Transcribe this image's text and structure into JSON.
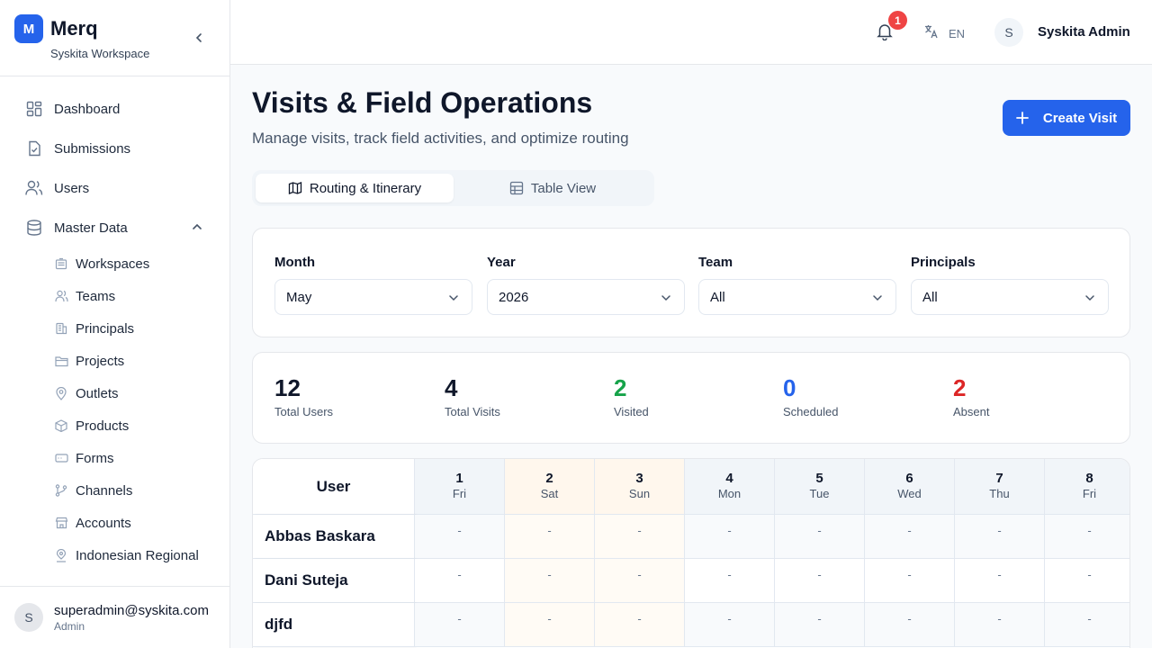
{
  "app": {
    "name": "Merq",
    "logo_letter": "M",
    "workspace": "Syskita Workspace"
  },
  "sidebar": {
    "items": [
      {
        "label": "Dashboard",
        "icon": "dashboard-icon"
      },
      {
        "label": "Submissions",
        "icon": "file-check-icon"
      },
      {
        "label": "Users",
        "icon": "users-icon"
      },
      {
        "label": "Master Data",
        "icon": "database-icon",
        "expanded": true
      }
    ],
    "sub_items": [
      {
        "label": "Workspaces",
        "icon": "building-icon"
      },
      {
        "label": "Teams",
        "icon": "users-icon"
      },
      {
        "label": "Principals",
        "icon": "office-icon"
      },
      {
        "label": "Projects",
        "icon": "folder-icon"
      },
      {
        "label": "Outlets",
        "icon": "map-pin-icon"
      },
      {
        "label": "Products",
        "icon": "box-icon"
      },
      {
        "label": "Forms",
        "icon": "form-icon"
      },
      {
        "label": "Channels",
        "icon": "branch-icon"
      },
      {
        "label": "Accounts",
        "icon": "store-icon"
      },
      {
        "label": "Indonesian Regional",
        "icon": "location-user-icon"
      }
    ],
    "footer": {
      "avatar_letter": "S",
      "email": "superadmin@syskita.com",
      "role": "Admin"
    }
  },
  "header": {
    "notification_count": "1",
    "language": "EN",
    "avatar_letter": "S",
    "user_name": "Syskita Admin"
  },
  "page": {
    "title": "Visits & Field Operations",
    "subtitle": "Manage visits, track field activities, and optimize routing",
    "create_label": "Create Visit"
  },
  "tabs": [
    {
      "label": "Routing & Itinerary",
      "active": true
    },
    {
      "label": "Table View",
      "active": false
    }
  ],
  "filters": [
    {
      "label": "Month",
      "value": "May"
    },
    {
      "label": "Year",
      "value": "2026"
    },
    {
      "label": "Team",
      "value": "All"
    },
    {
      "label": "Principals",
      "value": "All"
    }
  ],
  "stats": [
    {
      "value": "12",
      "label": "Total Users",
      "color": "#0f172a"
    },
    {
      "value": "4",
      "label": "Total Visits",
      "color": "#0f172a"
    },
    {
      "value": "2",
      "label": "Visited",
      "color": "#16a34a"
    },
    {
      "value": "0",
      "label": "Scheduled",
      "color": "#2563eb"
    },
    {
      "value": "2",
      "label": "Absent",
      "color": "#dc2626"
    }
  ],
  "table": {
    "user_header": "User",
    "days": [
      {
        "num": "1",
        "name": "Fri",
        "weekend": false
      },
      {
        "num": "2",
        "name": "Sat",
        "weekend": true
      },
      {
        "num": "3",
        "name": "Sun",
        "weekend": true
      },
      {
        "num": "4",
        "name": "Mon",
        "weekend": false
      },
      {
        "num": "5",
        "name": "Tue",
        "weekend": false
      },
      {
        "num": "6",
        "name": "Wed",
        "weekend": false
      },
      {
        "num": "7",
        "name": "Thu",
        "weekend": false
      },
      {
        "num": "8",
        "name": "Fri",
        "weekend": false
      }
    ],
    "rows": [
      {
        "user": "Abbas Baskara",
        "cells": [
          "-",
          "-",
          "-",
          "-",
          "-",
          "-",
          "-",
          "-"
        ]
      },
      {
        "user": "Dani Suteja",
        "cells": [
          "-",
          "-",
          "-",
          "-",
          "-",
          "-",
          "-",
          "-"
        ]
      },
      {
        "user": "djfd",
        "cells": [
          "-",
          "-",
          "-",
          "-",
          "-",
          "-",
          "-",
          "-"
        ]
      }
    ]
  },
  "colors": {
    "accent": "#2563eb",
    "badge": "#ef4444",
    "weekend": "#fff7ed"
  }
}
